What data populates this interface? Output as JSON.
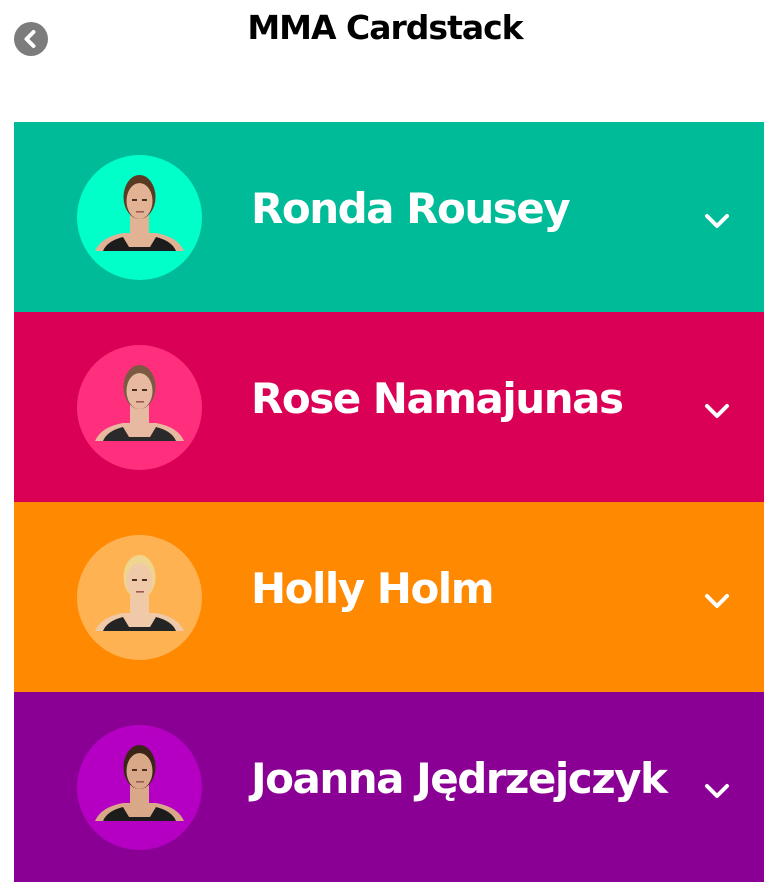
{
  "header": {
    "title": "MMA Cardstack",
    "back_icon": "chevron-left-circle-icon"
  },
  "cards": [
    {
      "name": "Ronda Rousey",
      "bg": "#00bb98",
      "avatar_bg": "#00ffc9",
      "hair": "#5a3a22",
      "skin": "#e2b294",
      "top": "#1c1c1c",
      "icon": "chevron-down-icon"
    },
    {
      "name": "Rose Namajunas",
      "bg": "#da0055",
      "avatar_bg": "#ff2f7d",
      "hair": "#7a5a42",
      "skin": "#e7b9a0",
      "top": "#2a2a2a",
      "icon": "chevron-down-icon"
    },
    {
      "name": "Holly Holm",
      "bg": "#ff8900",
      "avatar_bg": "#ffb252",
      "hair": "#f0d58e",
      "skin": "#f0c9a8",
      "top": "#242424",
      "icon": "chevron-down-icon"
    },
    {
      "name": "Joanna Jędrzejczyk",
      "bg": "#8a0095",
      "avatar_bg": "#b500c3",
      "hair": "#3a2518",
      "skin": "#d8a888",
      "top": "#1c1c1c",
      "icon": "chevron-down-icon"
    }
  ]
}
